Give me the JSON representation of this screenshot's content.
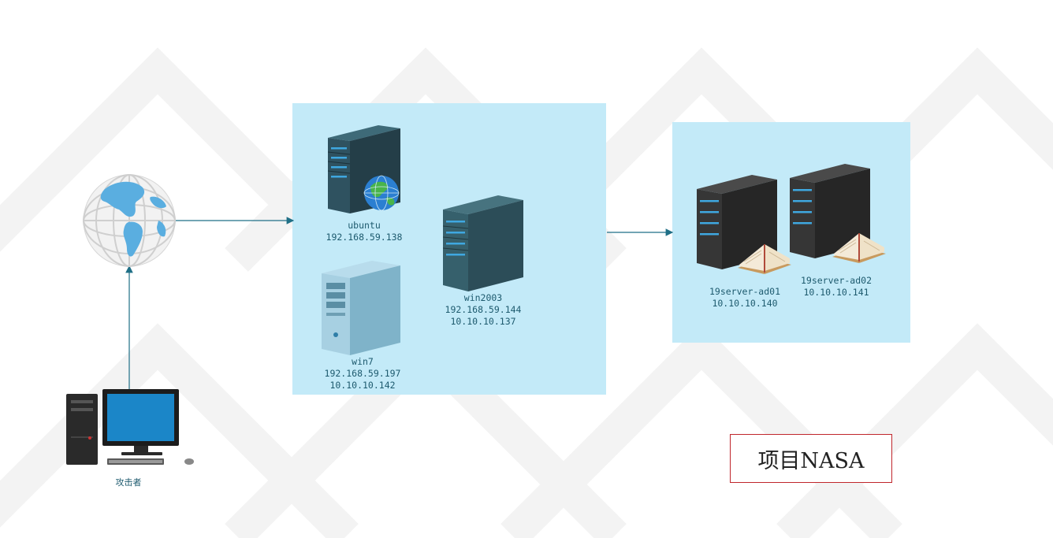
{
  "title": "项目NASA",
  "attacker": {
    "label": "攻击者"
  },
  "dmz": {
    "ubuntu": {
      "name": "ubuntu",
      "ip1": "192.168.59.138"
    },
    "win2003": {
      "name": "win2003",
      "ip1": "192.168.59.144",
      "ip2": "10.10.10.137"
    },
    "win7": {
      "name": "win7",
      "ip1": "192.168.59.197",
      "ip2": "10.10.10.142"
    }
  },
  "internal": {
    "ad01": {
      "name": "19server-ad01",
      "ip1": "10.10.10.140"
    },
    "ad02": {
      "name": "19server-ad02",
      "ip1": "10.10.10.141"
    }
  },
  "icons": {
    "internet": "globe-icon",
    "attacker": "desktop-computer-icon",
    "ubuntu": "web-server-icon",
    "win2003": "server-tower-icon",
    "win7": "pc-tower-icon",
    "ad01": "directory-server-icon",
    "ad02": "directory-server-icon"
  },
  "colors": {
    "zone_fill": "#c3eaf8",
    "link": "#1f6f86",
    "label": "#1d5a6e",
    "title_border": "#c0262c"
  }
}
